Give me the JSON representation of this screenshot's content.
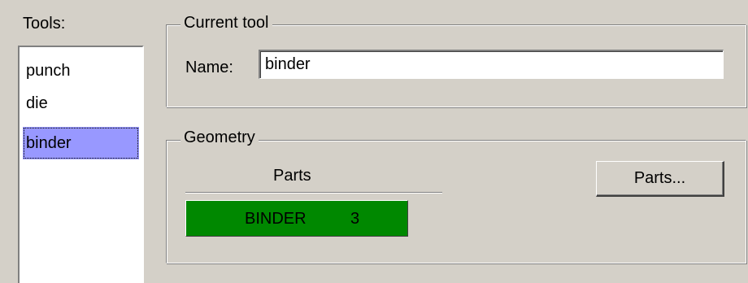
{
  "tools_panel": {
    "label": "Tools:",
    "items": [
      {
        "label": "punch"
      },
      {
        "label": "die"
      },
      {
        "label": "binder"
      }
    ]
  },
  "current_tool": {
    "title": "Current tool",
    "name_label": "Name:",
    "name_value": "binder"
  },
  "geometry": {
    "title": "Geometry",
    "parts_header": "Parts",
    "parts": [
      {
        "name": "BINDER",
        "count": "3"
      }
    ],
    "parts_button_label": "Parts...",
    "part_row_color": "#008800"
  },
  "colors": {
    "selection": "#9898ff",
    "background": "#d4d0c8"
  }
}
